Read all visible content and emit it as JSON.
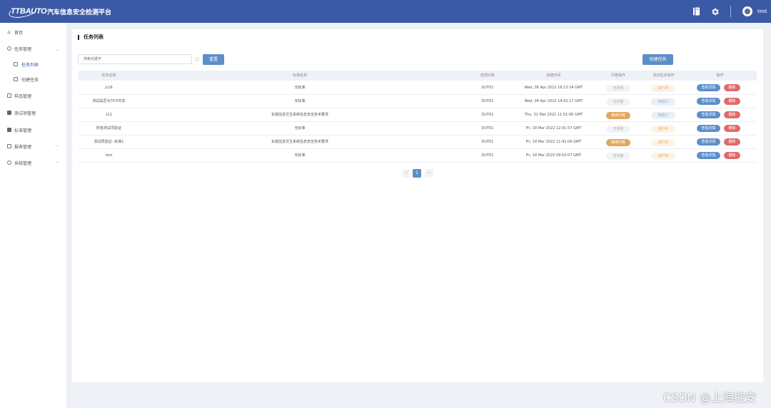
{
  "header": {
    "logo_text": "TTBAUTO",
    "app_title": "汽车信息安全检测平台",
    "user_name": "test",
    "icons": [
      "book-icon",
      "gear-icon",
      "avatar-icon"
    ]
  },
  "sidebar": {
    "items": [
      {
        "label": "首页",
        "icon": "home-icon"
      },
      {
        "label": "任务管理",
        "icon": "clock-icon",
        "expanded": true
      },
      {
        "label": "任务列表",
        "icon": "file-icon",
        "active": true
      },
      {
        "label": "创建任务",
        "icon": "file-icon"
      },
      {
        "label": "样品管理",
        "icon": "file-icon"
      },
      {
        "label": "测试项管理",
        "icon": "grid-icon"
      },
      {
        "label": "标准管理",
        "icon": "grid-icon"
      },
      {
        "label": "报表管理",
        "icon": "file-icon"
      },
      {
        "label": "系统管理",
        "icon": "settings-icon"
      }
    ]
  },
  "main": {
    "title": "任务列表",
    "search_placeholder": "搜索关键字",
    "reset_label": "重置",
    "create_label": "创建任务",
    "columns": [
      "任务名称",
      "标准名称",
      "检测对象",
      "创建时间",
      "问卷操作",
      "测试任务操作",
      "操作"
    ],
    "rows": [
      {
        "name": "jc16",
        "standard": "无标准",
        "target": "DUT01",
        "created": "Wed, 06 Apr 2022 16:13:34 GMT",
        "survey": "无问卷",
        "survey_style": "gray",
        "status": "进行中",
        "status_style": "yellow"
      },
      {
        "name": "测试是否为TICP共享",
        "standard": "无标准",
        "target": "DUT01",
        "created": "Wed, 06 Apr 2022 14:02:17 GMT",
        "survey": "无问卷",
        "survey_style": "gray",
        "status": "待执行",
        "status_style": "blue"
      },
      {
        "name": "111",
        "standard": "车载信息交互系统信息安全技术要求",
        "target": "DUT01",
        "created": "Thu, 31 Mar 2022 11:51:06 GMT",
        "survey": "继续问卷",
        "survey_style": "orange",
        "status": "待执行",
        "status_style": "blue"
      },
      {
        "name": "所有测试项验证",
        "standard": "无标准",
        "target": "DUT01",
        "created": "Fri, 18 Mar 2022 12:41:57 GMT",
        "survey": "无问卷",
        "survey_style": "gray",
        "status": "进行中",
        "status_style": "yellow"
      },
      {
        "name": "测试项验证--标准1",
        "standard": "车载信息交互系统信息安全技术要求",
        "target": "DUT01",
        "created": "Fri, 18 Mar 2022 11:41:06 GMT",
        "survey": "继续问卷",
        "survey_style": "orange",
        "status": "进行中",
        "status_style": "yellow"
      },
      {
        "name": "test",
        "standard": "无标准",
        "target": "DUT01",
        "created": "Fri, 18 Mar 2022 09:52:07 GMT",
        "survey": "无问卷",
        "survey_style": "gray",
        "status": "进行中",
        "status_style": "yellow"
      }
    ],
    "view_label": "查看详情",
    "delete_label": "删除",
    "pagination": {
      "prev": "<",
      "current": "1",
      "next": ">"
    }
  },
  "watermark": "CSDN @上海控安",
  "colors": {
    "header": "#3b5aa6",
    "primary_button": "#5b8fc8",
    "danger_button": "#de6b6b",
    "survey_orange": "#e3a75e"
  }
}
